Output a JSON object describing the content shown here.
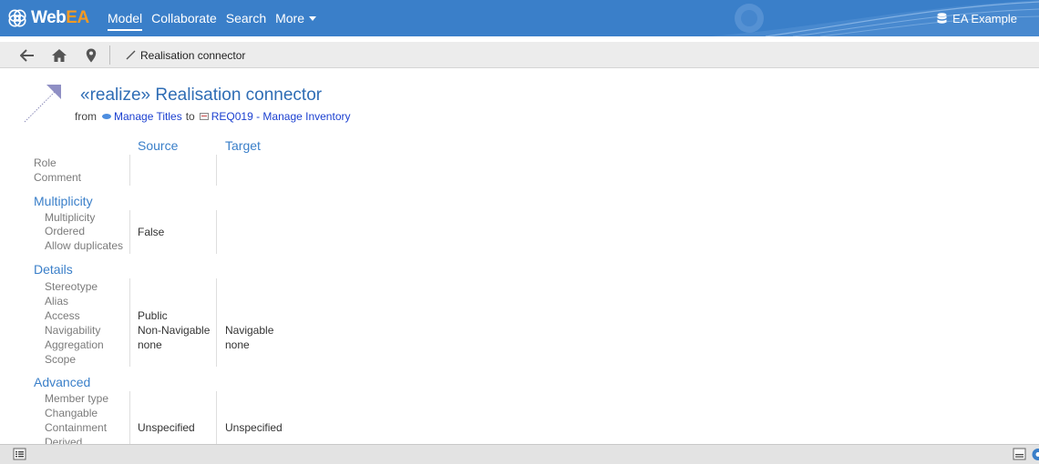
{
  "header": {
    "logo_text_main": "Web",
    "logo_text_accent": "EA",
    "nav": [
      "Model",
      "Collaborate",
      "Search",
      "More"
    ],
    "model_name": "EA Example",
    "colors": {
      "bar": "#3a7fc9",
      "logo_accent": "#f59a23"
    }
  },
  "navbar": {
    "back_icon": "arrow-left-icon",
    "home_icon": "home-icon",
    "location_icon": "map-marker-icon",
    "breadcrumb": "Realisation connector"
  },
  "connector": {
    "title": "«realize» Realisation connector",
    "from_label": "from",
    "source_name": "Manage Titles",
    "to_label": "to",
    "target_name": "REQ019 - Manage Inventory"
  },
  "columns": {
    "source": "Source",
    "target": "Target"
  },
  "general": {
    "role_label": "Role",
    "comment_label": "Comment"
  },
  "multiplicity": {
    "title": "Multiplicity",
    "multiplicity_label": "Multiplicity",
    "ordered_label": "Ordered",
    "ordered_source": "False",
    "allow_duplicates_label": "Allow duplicates"
  },
  "details": {
    "title": "Details",
    "stereotype_label": "Stereotype",
    "alias_label": "Alias",
    "access_label": "Access",
    "access_source": "Public",
    "navigability_label": "Navigability",
    "navigability_source": "Non-Navigable",
    "navigability_target": "Navigable",
    "aggregation_label": "Aggregation",
    "aggregation_source": "none",
    "aggregation_target": "none",
    "scope_label": "Scope"
  },
  "advanced": {
    "title": "Advanced",
    "member_type_label": "Member type",
    "changable_label": "Changable",
    "containment_label": "Containment",
    "containment_source": "Unspecified",
    "containment_target": "Unspecified",
    "derived_label": "Derived"
  },
  "statusbar": {
    "left_icon": "list-view-icon",
    "right_icon_1": "properties-panel-icon",
    "right_icon_2": "help-icon"
  }
}
